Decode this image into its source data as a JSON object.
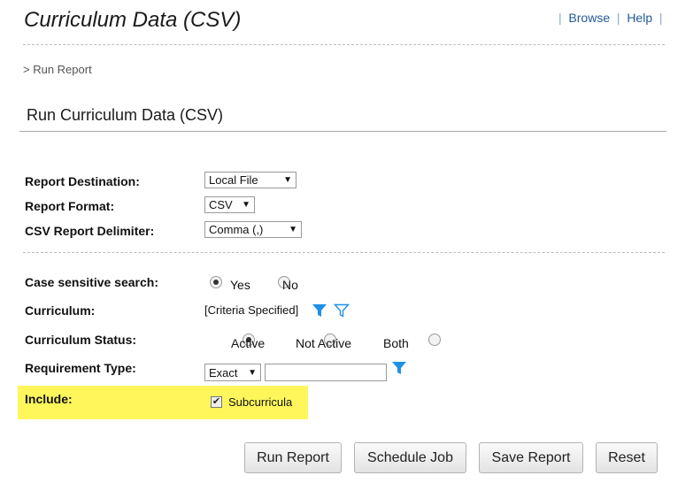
{
  "page": {
    "title": "Curriculum Data (CSV)",
    "links": {
      "browse": "Browse",
      "help": "Help",
      "sep": "|"
    },
    "breadcrumb": "> Run Report",
    "heading": "Run Curriculum Data (CSV)"
  },
  "form": {
    "report_destination": {
      "label": "Report Destination:",
      "value": "Local File"
    },
    "report_format": {
      "label": "Report Format:",
      "value": "CSV"
    },
    "csv_delimiter": {
      "label": "CSV Report Delimiter:",
      "value": "Comma (,)"
    },
    "case_sensitive": {
      "label": "Case sensitive search:",
      "options": [
        "Yes",
        "No"
      ],
      "selected": "Yes"
    },
    "curriculum": {
      "label": "Curriculum:",
      "value": "[Criteria Specified]"
    },
    "curriculum_status": {
      "label": "Curriculum Status:",
      "options": [
        "Active",
        "Not Active",
        "Both"
      ],
      "selected": "Active"
    },
    "requirement_type": {
      "label": "Requirement Type:",
      "match": "Exact",
      "value": ""
    },
    "include": {
      "label": "Include:",
      "option": "Subcurricula",
      "checked": true
    },
    "arrow": "▼",
    "check_mark": "✔"
  },
  "buttons": {
    "run_report": "Run Report",
    "schedule_job": "Schedule Job",
    "save_report": "Save Report",
    "reset": "Reset"
  },
  "colors": {
    "highlight": "#fef65b",
    "link": "#245a98",
    "filter_icon": "#1e90e8"
  },
  "icons": [
    "filter-filled-icon",
    "filter-outline-icon"
  ]
}
